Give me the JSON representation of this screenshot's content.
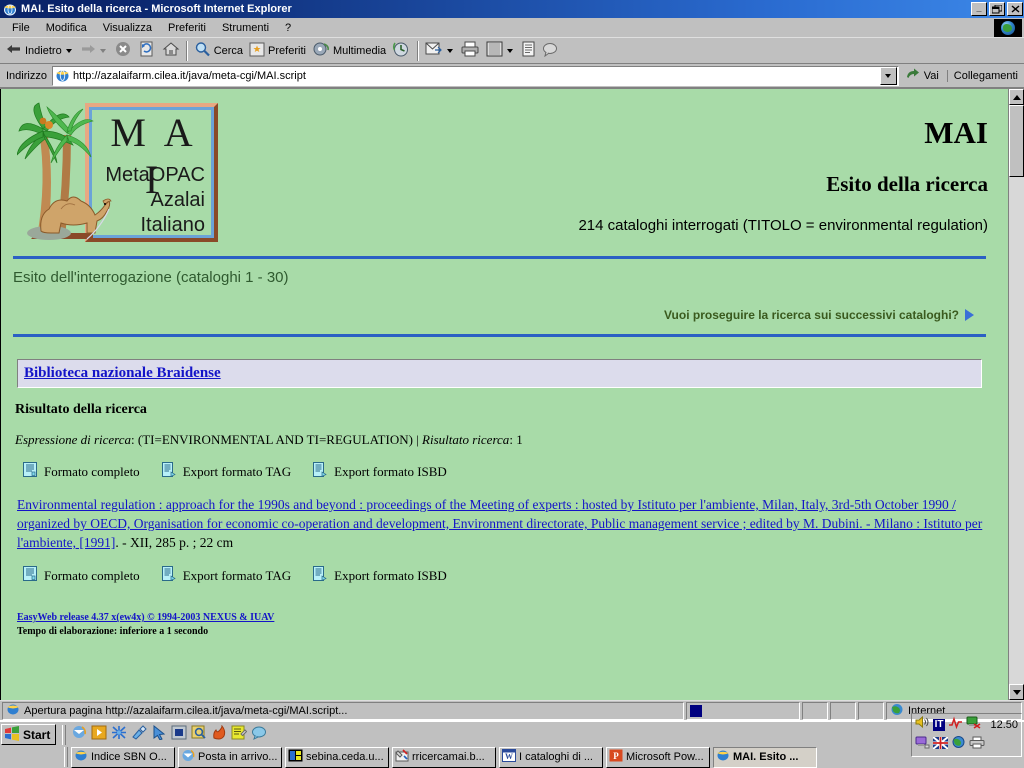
{
  "window": {
    "title": "MAI. Esito della ricerca - Microsoft Internet Explorer",
    "app_icon": "ie-icon",
    "minimize_label": "_",
    "restore_label": "❐",
    "close_label": "✕"
  },
  "menu": {
    "items": [
      {
        "label": "File",
        "name": "menu-file"
      },
      {
        "label": "Modifica",
        "name": "menu-modifica"
      },
      {
        "label": "Visualizza",
        "name": "menu-visualizza"
      },
      {
        "label": "Preferiti",
        "name": "menu-preferiti"
      },
      {
        "label": "Strumenti",
        "name": "menu-strumenti"
      },
      {
        "label": "?",
        "name": "menu-help"
      }
    ]
  },
  "toolbar": {
    "back_label": "Indietro",
    "forward_label": "",
    "search_label": "Cerca",
    "favorites_label": "Preferiti",
    "media_label": "Multimedia"
  },
  "address": {
    "label": "Indirizzo",
    "url": "http://azalaifarm.cilea.it/java/meta-cgi/MAI.script",
    "go_label": "Vai",
    "links_label": "Collegamenti"
  },
  "page": {
    "logo": {
      "title": "M A I",
      "line1": "MetaOPAC",
      "line2": "Azalai",
      "line3": "Italiano"
    },
    "header": {
      "brand": "MAI",
      "subtitle": "Esito della ricerca",
      "catalogs_line": "214 cataloghi interrogati (TITOLO = environmental regulation)"
    },
    "query_result_line": "Esito dell'interrogazione (cataloghi 1 - 30)",
    "continue_link": "Vuoi proseguire la ricerca sui successivi cataloghi?",
    "library_name": "Biblioteca nazionale Braidense",
    "result_title": "Risultato della ricerca",
    "expression_label": "Espressione di ricerca",
    "expression_value": "(TI=ENVIRONMENTAL AND TI=REGULATION)",
    "result_count_label": "Risultato ricerca",
    "result_count_value": "1",
    "format_links": [
      {
        "label": "Formato completo",
        "icon": "document-icon"
      },
      {
        "label": "Export formato TAG",
        "icon": "export-icon"
      },
      {
        "label": "Export formato ISBD",
        "icon": "export-icon"
      }
    ],
    "record": {
      "link_text": "Environmental regulation : approach for the 1990s and beyond : proceedings of the Meeting of experts : hosted by Istituto per l'ambiente, Milan, Italy, 3rd-5th October 1990 / organized by OECD, Organisation for economic co-operation and development, Environment directorate, Public management service ; edited by M. Dubini. - Milano : Istituto per l'ambiente, [1991]",
      "tail_text": ". - XII, 285 p. ; 22 cm"
    },
    "footer": {
      "release": "EasyWeb release 4.37 x(ew4x) © 1994-2003 NEXUS & IUAV",
      "timing": "Tempo di elaborazione: inferiore a 1 secondo"
    }
  },
  "statusbar": {
    "message": "Apertura pagina http://azalaifarm.cilea.it/java/meta-cgi/MAI.script...",
    "zone": "Internet"
  },
  "taskbar": {
    "start_label": "Start",
    "buttons": [
      {
        "label": "Indice SBN O...",
        "icon": "ie-icon",
        "active": false
      },
      {
        "label": "Posta in arrivo...",
        "icon": "outlook-icon",
        "active": false
      },
      {
        "label": "sebina.ceda.u...",
        "icon": "terminal-icon",
        "active": false
      },
      {
        "label": "rricercamai.b...",
        "icon": "paint-icon",
        "active": false
      },
      {
        "label": "I cataloghi di ...",
        "icon": "word-icon",
        "active": false
      },
      {
        "label": "Microsoft Pow...",
        "icon": "powerpoint-icon",
        "active": false
      },
      {
        "label": "MAI. Esito ...",
        "icon": "ie-icon",
        "active": true
      }
    ],
    "tray": {
      "language": "IT",
      "clock": "12.50"
    }
  },
  "colors": {
    "page_bg": "#a8dba8",
    "divider_blue": "#2b5fc4",
    "link_blue": "#1414c8",
    "libbox_bg": "#dcdcec",
    "title_bar": "#0a246a"
  }
}
